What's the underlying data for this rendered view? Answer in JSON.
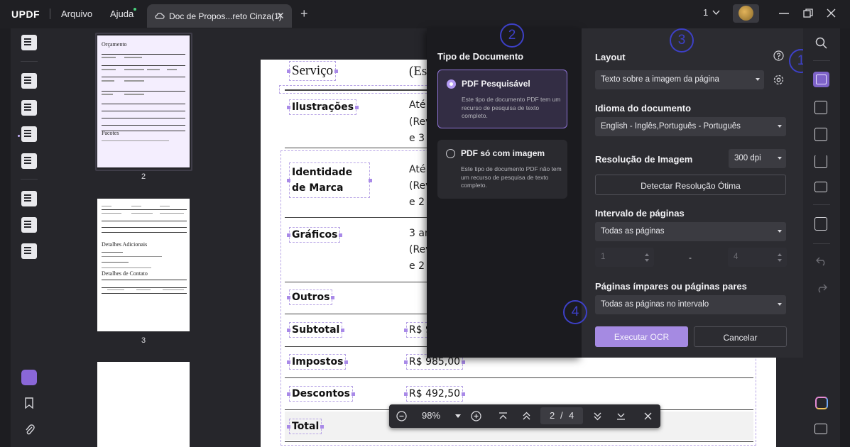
{
  "app": {
    "logo": "UPDF",
    "menu": [
      "Arquivo",
      "Ajuda"
    ],
    "tab_title": "Doc de Propos...reto Cinza(1)",
    "tab_close": "✕",
    "new_tab": "+",
    "window_count": "1",
    "window_controls": [
      "minimize-icon",
      "restore-icon",
      "close-icon"
    ]
  },
  "thumbnails": {
    "page2": {
      "number": "2",
      "heading": "Orçamento",
      "section": "Pacotes"
    },
    "page3": {
      "number": "3",
      "heading1": "Detalhes Adicionais",
      "heading2": "Detalhes de Contato",
      "contact_headers": [
        "Nome",
        "Telefone",
        "E-mail"
      ]
    }
  },
  "document": {
    "header_cells": [
      "Serviço",
      "(Es"
    ],
    "rows": [
      {
        "label": "Ilustrações",
        "value_lines": [
          "Até",
          "(Rev",
          "e 3"
        ]
      },
      {
        "label": "Identidade de Marca",
        "value_lines": [
          "Até",
          "(Rev",
          "e 2"
        ]
      },
      {
        "label": "Gráficos",
        "value_lines": [
          "3 an",
          "(Rev",
          "e 2"
        ]
      },
      {
        "label": "Outros",
        "value_lines": []
      },
      {
        "label": "Subtotal",
        "value_lines": [
          "R$ 9"
        ]
      },
      {
        "label": "Impostos",
        "value_lines": [
          "R$ 985,00"
        ]
      },
      {
        "label": "Descontos",
        "value_lines": [
          "R$ 492,50"
        ]
      },
      {
        "label": "Total",
        "value_lines": []
      }
    ]
  },
  "zoom_bar": {
    "zoom": "98%",
    "current_page": "2",
    "separator": "/",
    "total_pages": "4"
  },
  "ocr": {
    "doc_type_title": "Tipo de Documento",
    "options": [
      {
        "title": "PDF Pesquisável",
        "desc": "Este tipo de documento PDF tem um recurso de pesquisa de texto completo.",
        "selected": true
      },
      {
        "title": "PDF só com imagem",
        "desc": "Este tipo de documento PDF não tem um recurso de pesquisa de texto completo.",
        "selected": false
      }
    ],
    "layout_label": "Layout",
    "layout_value": "Texto sobre a imagem da página",
    "language_label": "Idioma do documento",
    "language_value": "English - Inglês,Português - Português",
    "resolution_label": "Resolução de Imagem",
    "resolution_value": "300 dpi",
    "detect_button": "Detectar Resolução Ótima",
    "range_label": "Intervalo de páginas",
    "range_value": "Todas as páginas",
    "range_from": "1",
    "range_dash": "-",
    "range_to": "4",
    "parity_label": "Páginas ímpares ou páginas pares",
    "parity_value": "Todas as páginas no intervalo",
    "run_button": "Executar OCR",
    "cancel_button": "Cancelar"
  },
  "callouts": [
    "1",
    "2",
    "3",
    "4"
  ],
  "colors": {
    "accent": "#8f74d6",
    "run_button_bg": "#a58ae2",
    "callout": "#3d40c7"
  }
}
